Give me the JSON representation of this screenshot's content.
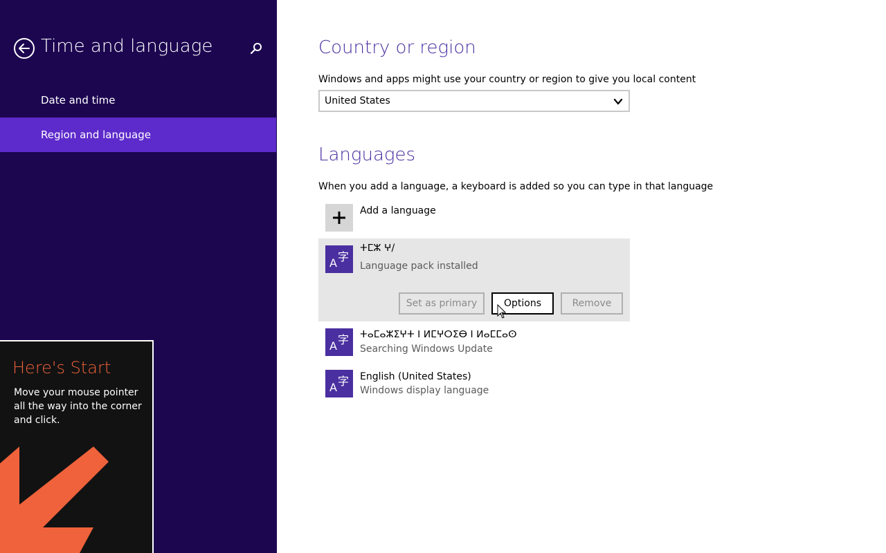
{
  "left_pane": {
    "title": "Time and language",
    "nav": [
      {
        "label": "Date and time",
        "selected": false
      },
      {
        "label": "Region and language",
        "selected": true
      }
    ]
  },
  "start_tip": {
    "title": "Here's Start",
    "body": "Move your mouse pointer all the way into the corner and click."
  },
  "country": {
    "title": "Country or region",
    "description": "Windows and apps might use your country or region to give you local content",
    "selected": "United States"
  },
  "languages": {
    "title": "Languages",
    "description": "When you add a language, a keyboard is added so you can type in that language",
    "add_label": "Add a language",
    "items": [
      {
        "name": "ⵜⵎⵣ ⵖ/",
        "status": "Language pack installed"
      },
      {
        "name": "ⵜⴰⵎⴰⵣⵉⵖⵜ ⵏ ⵍⵎⵖⵔⵉⴱ ⵏ ⵍⴰⵎⵎⴰⵙ",
        "status": "Searching Windows Update"
      },
      {
        "name": "English (United States)",
        "status": "Windows display language"
      }
    ],
    "buttons": {
      "set_primary": "Set as primary",
      "options": "Options",
      "remove": "Remove"
    }
  },
  "colors": {
    "pane_bg": "#1c0650",
    "nav_selected": "#5d2acb",
    "accent": "#4a2fa0",
    "tip_title": "#f0623b"
  }
}
